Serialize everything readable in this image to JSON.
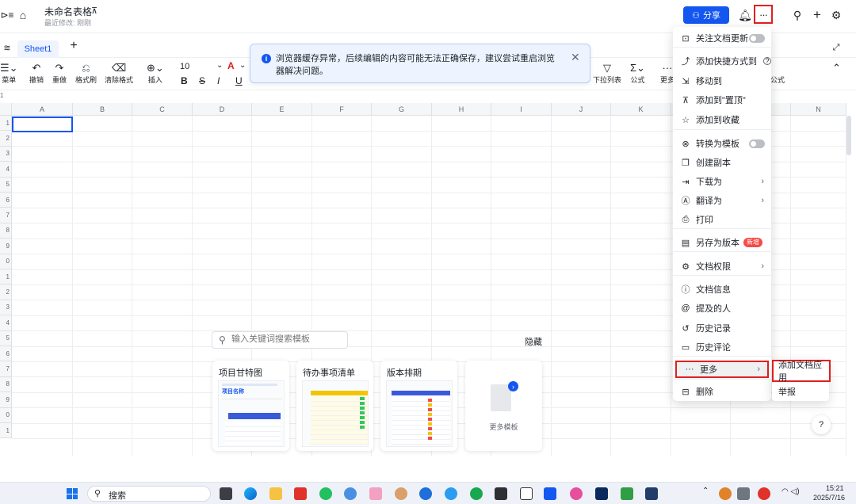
{
  "header": {
    "title": "未命名表格",
    "subtitle": "最近修改: 刚刚",
    "share_label": "分享",
    "more_glyph": "···"
  },
  "tabs": {
    "sheet_name": "Sheet1",
    "add_glyph": "+"
  },
  "toolbar": {
    "menu_label": "菜单",
    "undo_label": "撤销",
    "redo_label": "重做",
    "format_painter_label": "格式刷",
    "clear_format_label": "清除格式",
    "insert_label": "插入",
    "font_size": "10",
    "dropdown_list_label": "下拉列表",
    "formula_label": "公式",
    "more_label": "更多",
    "formula_label_2": "公式",
    "bold": "B",
    "strike": "S",
    "italic": "I",
    "underline": "U",
    "font_color": "A"
  },
  "notice": {
    "text": "浏览器缓存异常，后续编辑的内容可能无法正确保存，建议尝试重启浏览器解决问题。",
    "close_glyph": "✕",
    "info_glyph": "i"
  },
  "grid": {
    "columns": [
      "A",
      "B",
      "C",
      "D",
      "E",
      "F",
      "G",
      "H",
      "I",
      "J",
      "K",
      "L",
      "M",
      "N"
    ],
    "rows": [
      "1",
      "2",
      "3",
      "4",
      "5",
      "6",
      "7",
      "8",
      "9",
      "0",
      "1",
      "2",
      "3",
      "4",
      "5",
      "6",
      "7",
      "8",
      "9",
      "0",
      "1"
    ],
    "first_row_label": "1"
  },
  "templates": {
    "search_placeholder": "输入关键词搜索模板",
    "hide_label": "隐藏",
    "cards": [
      {
        "name": "项目甘特图",
        "thumb_title": "项目名称"
      },
      {
        "name": "待办事项清单"
      },
      {
        "name": "版本排期"
      }
    ],
    "more_label": "更多模板"
  },
  "menu": {
    "items": [
      {
        "label": "关注文档更新",
        "icon": "bookmark-icon",
        "glyph": "⊡",
        "toggle": true
      },
      {
        "label": "添加快捷方式到",
        "icon": "shortcut-icon",
        "glyph": "⤴",
        "help": "?"
      },
      {
        "label": "移动到",
        "icon": "move-icon",
        "glyph": "⇲"
      },
      {
        "label": "添加到\"置顶\"",
        "icon": "pin-icon",
        "glyph": "⊼"
      },
      {
        "label": "添加到收藏",
        "icon": "star-icon",
        "glyph": "☆"
      },
      {
        "label": "转换为模板",
        "icon": "template-icon",
        "glyph": "⊗",
        "toggle": true
      },
      {
        "label": "创建副本",
        "icon": "copy-icon",
        "glyph": "❐"
      },
      {
        "label": "下载为",
        "icon": "download-icon",
        "glyph": "⇥",
        "submenu": true
      },
      {
        "label": "翻译为",
        "icon": "translate-icon",
        "glyph": "Ⓐ",
        "submenu": true
      },
      {
        "label": "打印",
        "icon": "print-icon",
        "glyph": "⎙"
      },
      {
        "label": "另存为版本",
        "icon": "version-icon",
        "glyph": "▤",
        "badge": "新增"
      },
      {
        "label": "文档权限",
        "icon": "permission-icon",
        "glyph": "⚙",
        "submenu": true
      },
      {
        "label": "文档信息",
        "icon": "info-icon",
        "glyph": "ⓘ"
      },
      {
        "label": "提及的人",
        "icon": "at-icon",
        "glyph": "@"
      },
      {
        "label": "历史记录",
        "icon": "history-icon",
        "glyph": "↺"
      },
      {
        "label": "历史评论",
        "icon": "comment-icon",
        "glyph": "▭"
      },
      {
        "label": "更多",
        "icon": "more-dots-icon",
        "glyph": "···",
        "submenu": true
      },
      {
        "label": "删除",
        "icon": "trash-icon",
        "glyph": "⊟"
      }
    ],
    "arrow_glyph": "›"
  },
  "submenu": {
    "add_app": "添加文档应用",
    "report": "举报"
  },
  "help_glyph": "?",
  "taskbar": {
    "search_label": "搜索",
    "time": "15:21",
    "date": "2025/7/16"
  },
  "colors": {
    "accent": "#1456f0",
    "highlight": "#e02020",
    "badge": "#f54a45"
  }
}
